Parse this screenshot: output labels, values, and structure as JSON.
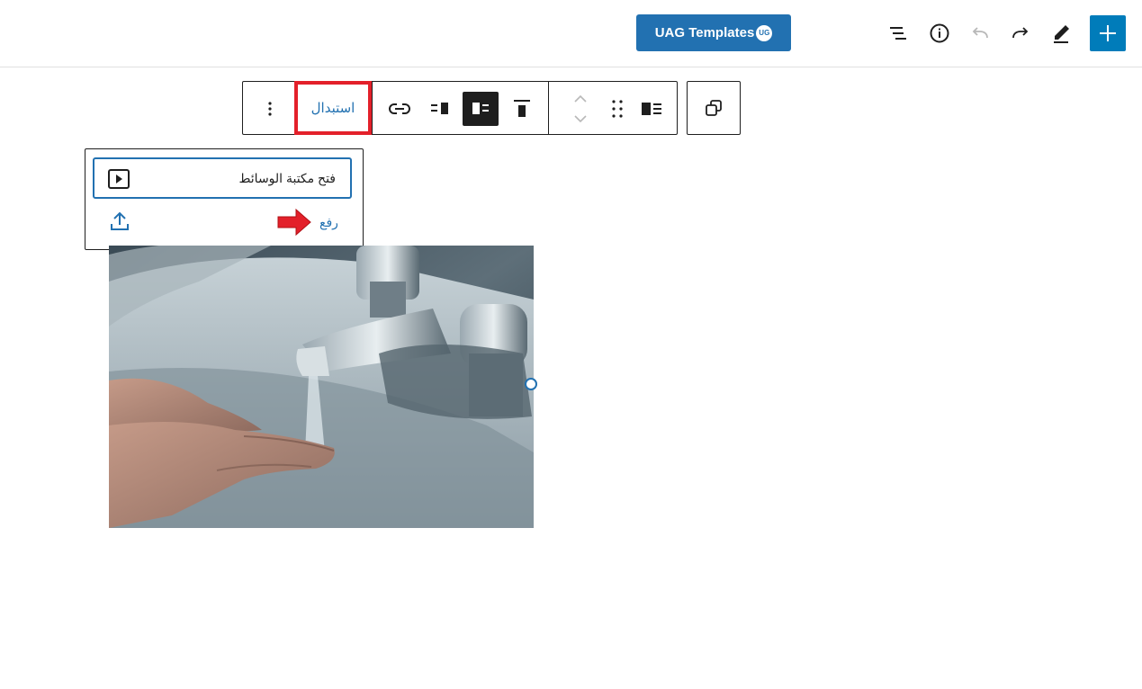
{
  "header": {
    "uag_templates_label": "UAG Templates",
    "uag_badge": "UG",
    "icons": [
      "plus-icon",
      "pencil-icon",
      "redo-icon",
      "undo-icon",
      "info-icon",
      "list-view-icon"
    ]
  },
  "block_toolbar": {
    "replace_label": "استبدال",
    "buttons": [
      "more-options",
      "link",
      "align-right",
      "align-left",
      "align-top",
      "move-up-down",
      "drag",
      "media-text"
    ]
  },
  "replace_menu": {
    "open_media_library_label": "فتح مكتبة الوسائط",
    "upload_label": "رفع"
  },
  "colors": {
    "accent": "#007cba",
    "uag_button": "#2271b1",
    "highlight": "#e3202a",
    "link": "#2271b1"
  }
}
